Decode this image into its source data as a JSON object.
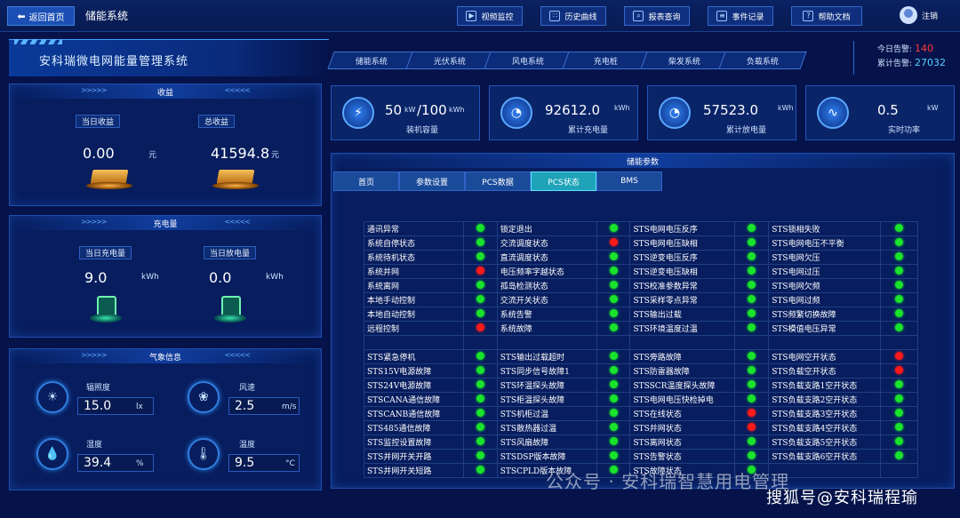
{
  "topbar": {
    "back_label": "返回首页",
    "system_title": "储能系统",
    "nav": [
      {
        "label": "视频监控",
        "icon": "video-icon"
      },
      {
        "label": "历史曲线",
        "icon": "chart-icon"
      },
      {
        "label": "报表查询",
        "icon": "search-icon"
      },
      {
        "label": "事件记录",
        "icon": "document-icon"
      },
      {
        "label": "帮助文档",
        "icon": "help-icon"
      }
    ],
    "logout_label": "注销"
  },
  "banner": {
    "title": "安科瑞微电网能量管理系统"
  },
  "subsystem_tabs": [
    "储能系统",
    "光伏系统",
    "风电系统",
    "充电桩",
    "柴发系统",
    "负载系统"
  ],
  "alarms": {
    "today_label": "今日告警:",
    "today_value": "140",
    "today_color": "#ff3b3b",
    "total_label": "累计告警:",
    "total_value": "27032",
    "total_color": "#4fd3ff"
  },
  "revenue": {
    "title": "收益",
    "today_label": "当日收益",
    "today_value": "0.00",
    "total_label": "总收益",
    "total_value": "41594.8",
    "unit": "元"
  },
  "energy": {
    "title": "充电量",
    "charge_label": "当日充电量",
    "charge_value": "9.0",
    "discharge_label": "当日放电量",
    "discharge_value": "0.0",
    "unit": "kWh"
  },
  "weather": {
    "title": "气象信息",
    "items": [
      {
        "label": "辐照度",
        "value": "15.0",
        "unit": "lx"
      },
      {
        "label": "风速",
        "value": "2.5",
        "unit": "m/s"
      },
      {
        "label": "湿度",
        "value": "39.4",
        "unit": "%"
      },
      {
        "label": "温度",
        "value": "9.5",
        "unit": "°C"
      }
    ]
  },
  "stats": [
    {
      "value": "50",
      "unit1": "kW",
      "value2": "/100",
      "unit2": "kWh",
      "label": "装机容量"
    },
    {
      "value": "92612.0",
      "unit": "kWh",
      "label": "累计充电量"
    },
    {
      "value": "57523.0",
      "unit": "kWh",
      "label": "累计放电量"
    },
    {
      "value": "0.5",
      "unit": "kW",
      "label": "实时功率"
    }
  ],
  "params": {
    "title": "储能参数",
    "tabs": [
      "首页",
      "参数设置",
      "PCS数据",
      "PCS状态",
      "BMS"
    ],
    "active_tab": 3,
    "rows_top": [
      [
        "通讯异常",
        "g",
        "锁定退出",
        "g",
        "STS电网电压反序",
        "g",
        "STS锁相失败",
        "g"
      ],
      [
        "系统自停状态",
        "g",
        "交流调度状态",
        "r",
        "STS电网电压缺相",
        "g",
        "STS电网电压不平衡",
        "g"
      ],
      [
        "系统待机状态",
        "g",
        "直流调度状态",
        "g",
        "STS逆变电压反序",
        "g",
        "STS电网欠压",
        "g"
      ],
      [
        "系统并网",
        "r",
        "电压频率字越状态",
        "g",
        "STS逆变电压缺相",
        "g",
        "STS电网过压",
        "g"
      ],
      [
        "系统离网",
        "g",
        "孤岛检测状态",
        "g",
        "STS校准参数异常",
        "g",
        "STS电网欠频",
        "g"
      ],
      [
        "本地手动控制",
        "g",
        "交流开关状态",
        "g",
        "STS采样零点异常",
        "g",
        "STS电网过频",
        "g"
      ],
      [
        "本地自动控制",
        "g",
        "系统告警",
        "g",
        "STS输出过载",
        "g",
        "STS频繁切换故障",
        "g"
      ],
      [
        "远程控制",
        "r",
        "系统故障",
        "g",
        "STS环境温度过温",
        "g",
        "STS模值电压异常",
        "g"
      ]
    ],
    "rows_bottom": [
      [
        "STS紧急停机",
        "g",
        "STS输出过载超时",
        "g",
        "STS旁路故障",
        "g",
        "STS电网空开状态",
        "r"
      ],
      [
        "STS15V电源故障",
        "g",
        "STS同步信号故障1",
        "g",
        "STS防雷器故障",
        "g",
        "STS负载空开状态",
        "r"
      ],
      [
        "STS24V电源故障",
        "g",
        "STS环温探头故障",
        "g",
        "STSSCR温度探头故障",
        "g",
        "STS负载支路1空开状态",
        "g"
      ],
      [
        "STSCANA通信故障",
        "g",
        "STS柜温探头故障",
        "g",
        "STS电网电压快检掉电",
        "g",
        "STS负载支路2空开状态",
        "g"
      ],
      [
        "STSCANB通信故障",
        "g",
        "STS机柜过温",
        "g",
        "STS在线状态",
        "r",
        "STS负载支路3空开状态",
        "g"
      ],
      [
        "STS485通信故障",
        "g",
        "STS散热器过温",
        "g",
        "STS并网状态",
        "r",
        "STS负载支路4空开状态",
        "g"
      ],
      [
        "STS监控设置故障",
        "g",
        "STS风扇故障",
        "g",
        "STS离网状态",
        "g",
        "STS负载支路5空开状态",
        "g"
      ],
      [
        "STS并网开关开路",
        "g",
        "STSDSP版本故障",
        "g",
        "STS告警状态",
        "g",
        "STS负载支路6空开状态",
        "g"
      ],
      [
        "STS并网开关短路",
        "g",
        "STSCPLD版本故障",
        "g",
        "STS故障状态",
        "g",
        "",
        "g"
      ]
    ]
  },
  "watermarks": {
    "wm1": "公众号 · 安科瑞智慧用电管理",
    "wm2": "搜狐号@安科瑞程瑜"
  }
}
